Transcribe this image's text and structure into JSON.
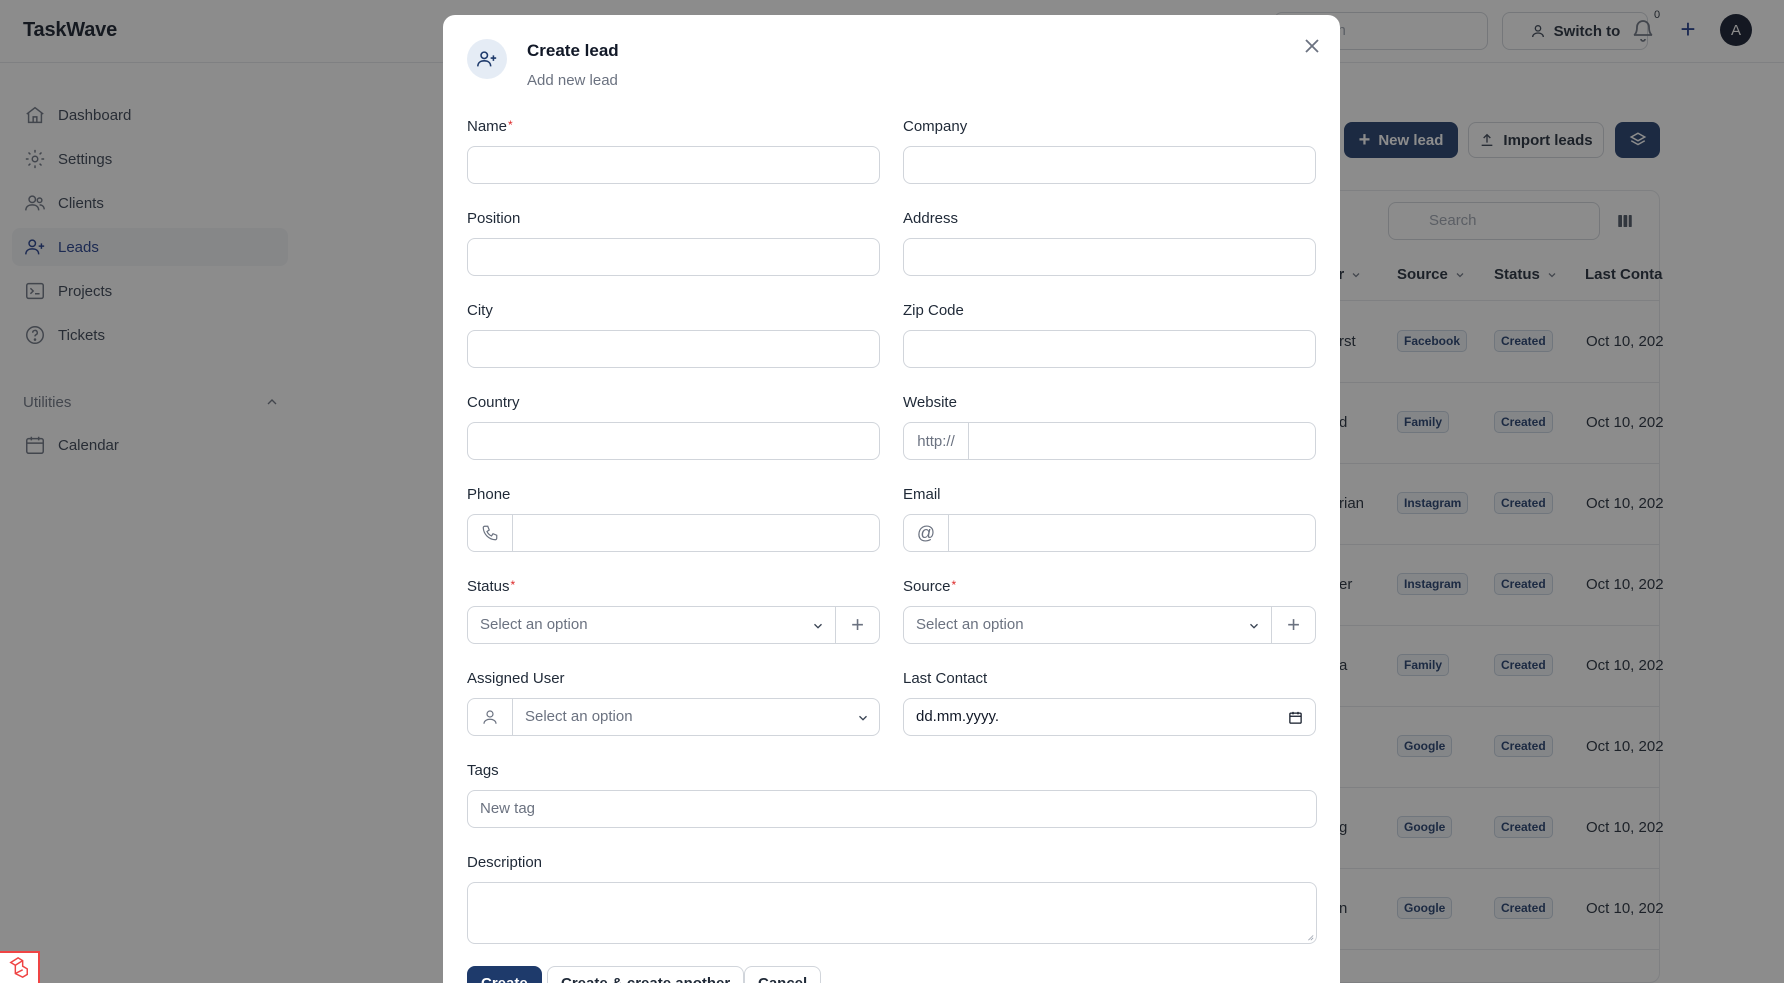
{
  "app": {
    "brand": "TaskWave",
    "search_partial": "rch",
    "switch_label": "Switch to",
    "notif_count": "0",
    "avatar_initial": "A"
  },
  "sidebar": {
    "items": [
      {
        "label": "Dashboard",
        "icon": "home-icon"
      },
      {
        "label": "Settings",
        "icon": "gear-icon"
      },
      {
        "label": "Clients",
        "icon": "users-icon"
      },
      {
        "label": "Leads",
        "icon": "user-plus-icon",
        "active": true
      },
      {
        "label": "Projects",
        "icon": "terminal-icon"
      },
      {
        "label": "Tickets",
        "icon": "question-icon"
      }
    ],
    "section_label": "Utilities",
    "utility_items": [
      {
        "label": "Calendar",
        "icon": "calendar-icon"
      }
    ]
  },
  "content": {
    "new_lead_label": "New lead",
    "import_leads_label": "Import leads",
    "search_placeholder": "Search",
    "columns": [
      "er",
      "Source",
      "Status",
      "Last Conta"
    ],
    "rows": [
      {
        "owner": "rst",
        "source": "Facebook",
        "status": "Created",
        "last_contact": "Oct 10, 202"
      },
      {
        "owner": "d",
        "source": "Family",
        "status": "Created",
        "last_contact": "Oct 10, 202"
      },
      {
        "owner": "rian",
        "source": "Instagram",
        "status": "Created",
        "last_contact": "Oct 10, 202"
      },
      {
        "owner": "er",
        "source": "Instagram",
        "status": "Created",
        "last_contact": "Oct 10, 202"
      },
      {
        "owner": "a",
        "source": "Family",
        "status": "Created",
        "last_contact": "Oct 10, 202"
      },
      {
        "owner": "",
        "source": "Google",
        "status": "Created",
        "last_contact": "Oct 10, 202"
      },
      {
        "owner": "g",
        "source": "Google",
        "status": "Created",
        "last_contact": "Oct 10, 202"
      },
      {
        "owner": "n",
        "source": "Google",
        "status": "Created",
        "last_contact": "Oct 10, 202"
      }
    ]
  },
  "modal": {
    "title": "Create lead",
    "subtitle": "Add new lead",
    "fields": {
      "name": {
        "label": "Name",
        "required": "*"
      },
      "company": {
        "label": "Company"
      },
      "position": {
        "label": "Position"
      },
      "address": {
        "label": "Address"
      },
      "city": {
        "label": "City"
      },
      "zip": {
        "label": "Zip Code"
      },
      "country": {
        "label": "Country"
      },
      "website": {
        "label": "Website",
        "prefix": "http://"
      },
      "phone": {
        "label": "Phone"
      },
      "email": {
        "label": "Email",
        "prefix": "@"
      },
      "status": {
        "label": "Status",
        "required": "*",
        "placeholder": "Select an option"
      },
      "source": {
        "label": "Source",
        "required": "*",
        "placeholder": "Select an option"
      },
      "assigned_user": {
        "label": "Assigned User",
        "placeholder": "Select an option"
      },
      "last_contact": {
        "label": "Last Contact",
        "value": "dd.mm.yyyy."
      },
      "tags": {
        "label": "Tags",
        "placeholder": "New tag"
      },
      "description": {
        "label": "Description"
      }
    },
    "buttons": {
      "create": "Create",
      "create_another": "Create & create another",
      "cancel": "Cancel"
    }
  }
}
